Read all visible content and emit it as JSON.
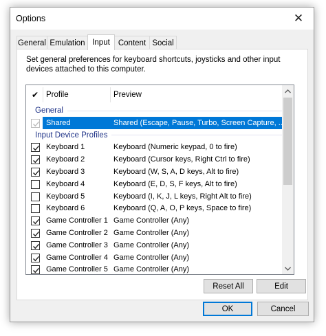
{
  "window": {
    "title": "Options",
    "close_glyph": "✕"
  },
  "tabs": [
    {
      "label": "General",
      "active": false
    },
    {
      "label": "Emulation",
      "active": false
    },
    {
      "label": "Input",
      "active": true
    },
    {
      "label": "Content",
      "active": false
    },
    {
      "label": "Social",
      "active": false
    }
  ],
  "description": "Set general preferences for keyboard shortcuts, joysticks and other input devices attached to this computer.",
  "list": {
    "headers": {
      "check": "✔",
      "profile": "Profile",
      "preview": "Preview"
    },
    "groups": [
      {
        "name": "General",
        "items": [
          {
            "checked": true,
            "disabled": true,
            "selected": true,
            "profile": "Shared",
            "preview": "Shared (Escape, Pause, Turbo, Screen Capture, ..."
          }
        ]
      },
      {
        "name": "Input Device Profiles",
        "items": [
          {
            "checked": true,
            "profile": "Keyboard 1",
            "preview": "Keyboard (Numeric keypad, 0 to fire)"
          },
          {
            "checked": true,
            "profile": "Keyboard 2",
            "preview": "Keyboard (Cursor keys, Right Ctrl to fire)"
          },
          {
            "checked": true,
            "profile": "Keyboard 3",
            "preview": "Keyboard (W, S, A, D keys, Alt to fire)"
          },
          {
            "checked": false,
            "profile": "Keyboard 4",
            "preview": "Keyboard (E, D, S, F keys, Alt to fire)"
          },
          {
            "checked": false,
            "profile": "Keyboard 5",
            "preview": "Keyboard (I, K, J, L keys, Right Alt to fire)"
          },
          {
            "checked": false,
            "profile": "Keyboard 6",
            "preview": "Keyboard (Q, A, O, P keys, Space to fire)"
          },
          {
            "checked": true,
            "profile": "Game Controller 1",
            "preview": "Game Controller (Any)"
          },
          {
            "checked": true,
            "profile": "Game Controller 2",
            "preview": "Game Controller (Any)"
          },
          {
            "checked": true,
            "profile": "Game Controller 3",
            "preview": "Game Controller (Any)"
          },
          {
            "checked": true,
            "profile": "Game Controller 4",
            "preview": "Game Controller (Any)"
          },
          {
            "checked": true,
            "profile": "Game Controller 5",
            "preview": "Game Controller (Any)"
          }
        ]
      }
    ]
  },
  "buttons": {
    "reset_all": "Reset All",
    "edit": "Edit",
    "ok": "OK",
    "cancel": "Cancel"
  },
  "colors": {
    "selection": "#0078d7",
    "group_header": "#1e3287",
    "default_button_border": "#0078d7"
  }
}
